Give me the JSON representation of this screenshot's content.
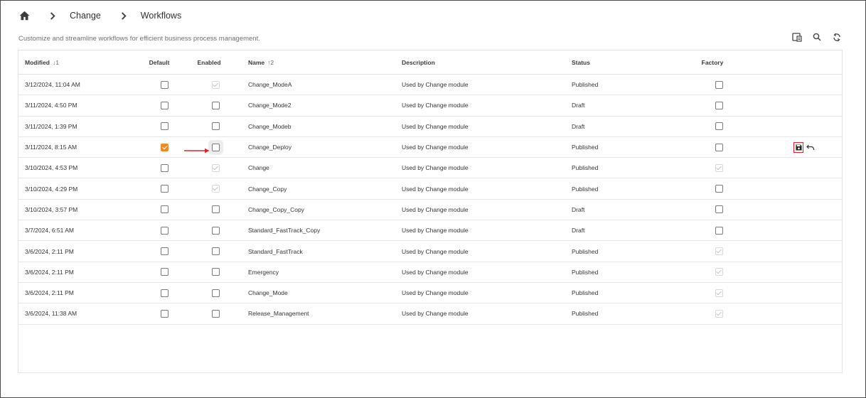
{
  "breadcrumb": {
    "home_icon": "home-icon",
    "separator_icon": "chevron-right-icon",
    "items": [
      "Change",
      "Workflows"
    ]
  },
  "subtitle": "Customize and streamline workflows for efficient business process management.",
  "toolbar": {
    "icons": [
      "table-settings-icon",
      "search-icon",
      "refresh-icon"
    ]
  },
  "colors": {
    "accent": "#f08a24",
    "highlight": "#e0222b"
  },
  "table": {
    "headers": {
      "modified": "Modified",
      "modified_sort": "↓1",
      "default": "Default",
      "enabled": "Enabled",
      "name": "Name",
      "name_sort": "↑2",
      "description": "Description",
      "status": "Status",
      "factory": "Factory"
    },
    "rows": [
      {
        "modified": "3/12/2024, 11:04 AM",
        "default": "unchecked",
        "enabled": "checked-disabled",
        "name": "Change_ModeA",
        "description": "Used by Change module",
        "status": "Published",
        "factory": "unchecked"
      },
      {
        "modified": "3/11/2024, 4:50 PM",
        "default": "unchecked",
        "enabled": "unchecked",
        "name": "Change_Mode2",
        "description": "Used by Change module",
        "status": "Draft",
        "factory": "unchecked"
      },
      {
        "modified": "3/11/2024, 1:39 PM",
        "default": "unchecked",
        "enabled": "unchecked",
        "name": "Change_Modeb",
        "description": "Used by Change module",
        "status": "Draft",
        "factory": "unchecked"
      },
      {
        "modified": "3/11/2024, 8:15 AM",
        "default": "checked-orange",
        "enabled": "unchecked-focused",
        "name": "Change_Deploy",
        "description": "Used by Change module",
        "status": "Published",
        "factory": "unchecked",
        "edited": true
      },
      {
        "modified": "3/10/2024, 4:53 PM",
        "default": "unchecked",
        "enabled": "checked-disabled",
        "name": "Change",
        "description": "Used by Change module",
        "status": "Published",
        "factory": "checked-disabled"
      },
      {
        "modified": "3/10/2024, 4:29 PM",
        "default": "unchecked",
        "enabled": "checked-disabled",
        "name": "Change_Copy",
        "description": "Used by Change module",
        "status": "Published",
        "factory": "unchecked"
      },
      {
        "modified": "3/10/2024, 3:57 PM",
        "default": "unchecked",
        "enabled": "unchecked",
        "name": "Change_Copy_Copy",
        "description": "Used by Change module",
        "status": "Draft",
        "factory": "unchecked"
      },
      {
        "modified": "3/7/2024, 6:51 AM",
        "default": "unchecked",
        "enabled": "unchecked",
        "name": "Standard_FastTrack_Copy",
        "description": "Used by Change module",
        "status": "Draft",
        "factory": "unchecked"
      },
      {
        "modified": "3/6/2024, 2:11 PM",
        "default": "unchecked",
        "enabled": "unchecked",
        "name": "Standard_FastTrack",
        "description": "Used by Change module",
        "status": "Published",
        "factory": "checked-disabled"
      },
      {
        "modified": "3/6/2024, 2:11 PM",
        "default": "unchecked",
        "enabled": "unchecked",
        "name": "Emergency",
        "description": "Used by Change module",
        "status": "Published",
        "factory": "checked-disabled"
      },
      {
        "modified": "3/6/2024, 2:11 PM",
        "default": "unchecked",
        "enabled": "unchecked",
        "name": "Change_Mode",
        "description": "Used by Change module",
        "status": "Published",
        "factory": "checked-disabled"
      },
      {
        "modified": "3/6/2024, 11:38 AM",
        "default": "unchecked",
        "enabled": "unchecked",
        "name": "Release_Management",
        "description": "Used by Change module",
        "status": "Published",
        "factory": "checked-disabled"
      }
    ],
    "row_actions": {
      "save_icon": "save-icon",
      "undo_icon": "undo-icon"
    }
  }
}
